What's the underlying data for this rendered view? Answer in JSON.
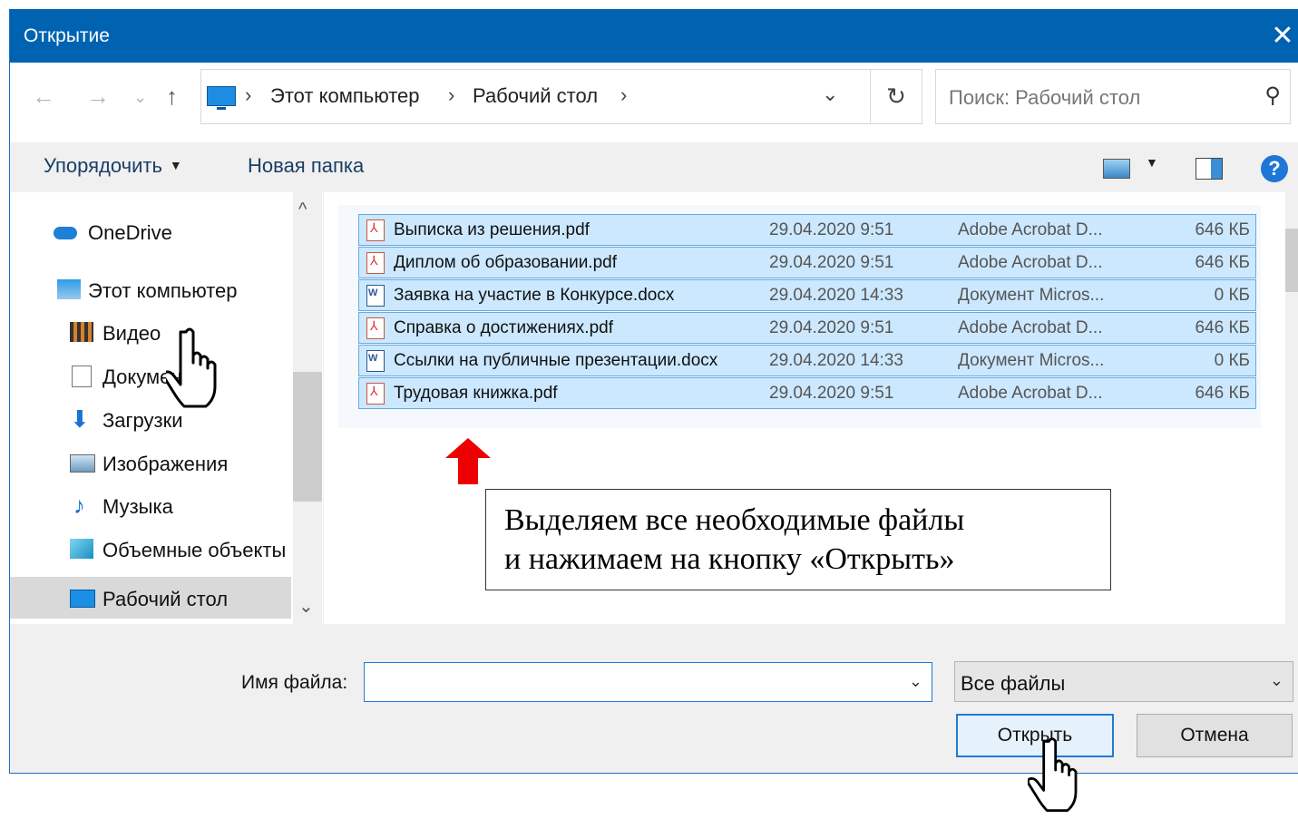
{
  "window": {
    "title": "Открытие",
    "close_glyph": "✕"
  },
  "nav": {
    "back": "←",
    "forward": "→",
    "recent": "⌄",
    "up": "↑",
    "breadcrumb": [
      "Этот компьютер",
      "Рабочий стол"
    ],
    "separator": "›",
    "refresh": "↻",
    "dropdown": "⌄"
  },
  "search": {
    "placeholder": "Поиск: Рабочий стол",
    "icon": "search-icon"
  },
  "toolbar": {
    "organize_label": "Упорядочить",
    "organize_caret": "▼",
    "new_folder_label": "Новая папка",
    "view_caret": "▼",
    "help_label": "?"
  },
  "sidebar": {
    "items": [
      {
        "label": "OneDrive",
        "icon": "onedrive-cloud-icon"
      },
      {
        "label": "Этот компьютер",
        "icon": "computer-icon"
      },
      {
        "label": "Видео",
        "icon": "video-icon"
      },
      {
        "label": "Документы",
        "icon": "documents-icon"
      },
      {
        "label": "Загрузки",
        "icon": "downloads-icon",
        "glyph": "⬇"
      },
      {
        "label": "Изображения",
        "icon": "pictures-icon"
      },
      {
        "label": "Музыка",
        "icon": "music-icon",
        "glyph": "♪"
      },
      {
        "label": "Объемные объекты",
        "icon": "3d-objects-icon"
      },
      {
        "label": "Рабочий стол",
        "icon": "desktop-icon",
        "selected": true
      }
    ],
    "scroll_up": "^",
    "scroll_down": "⌄"
  },
  "files": [
    {
      "name": "Выписка из решения.pdf",
      "date": "29.04.2020 9:51",
      "type": "Adobe Acrobat D...",
      "size": "646 КБ",
      "kind": "pdf"
    },
    {
      "name": "Диплом об образовании.pdf",
      "date": "29.04.2020 9:51",
      "type": "Adobe Acrobat D...",
      "size": "646 КБ",
      "kind": "pdf"
    },
    {
      "name": "Заявка на участие в Конкурсе.docx",
      "date": "29.04.2020 14:33",
      "type": "Документ Micros...",
      "size": "0 КБ",
      "kind": "docx"
    },
    {
      "name": "Справка о достижениях.pdf",
      "date": "29.04.2020 9:51",
      "type": "Adobe Acrobat D...",
      "size": "646 КБ",
      "kind": "pdf"
    },
    {
      "name": "Ссылки на публичные презентации.docx",
      "date": "29.04.2020 14:33",
      "type": "Документ Micros...",
      "size": "0 КБ",
      "kind": "docx"
    },
    {
      "name": "Трудовая книжка.pdf",
      "date": "29.04.2020 9:51",
      "type": "Adobe Acrobat D...",
      "size": "646 КБ",
      "kind": "pdf"
    }
  ],
  "annotation": {
    "line1": "Выделяем все необходимые файлы",
    "line2": "и нажимаем на кнопку «Открыть»",
    "arrow_color": "#e00000"
  },
  "bottom": {
    "filename_label": "Имя файла:",
    "filename_value": "",
    "filter_value": "Все файлы",
    "dropdown": "⌄",
    "open_label": "Открыть",
    "cancel_label": "Отмена"
  },
  "colors": {
    "titlebar": "#0063b1",
    "selection": "#cce8ff",
    "accent": "#1e7bd6"
  }
}
